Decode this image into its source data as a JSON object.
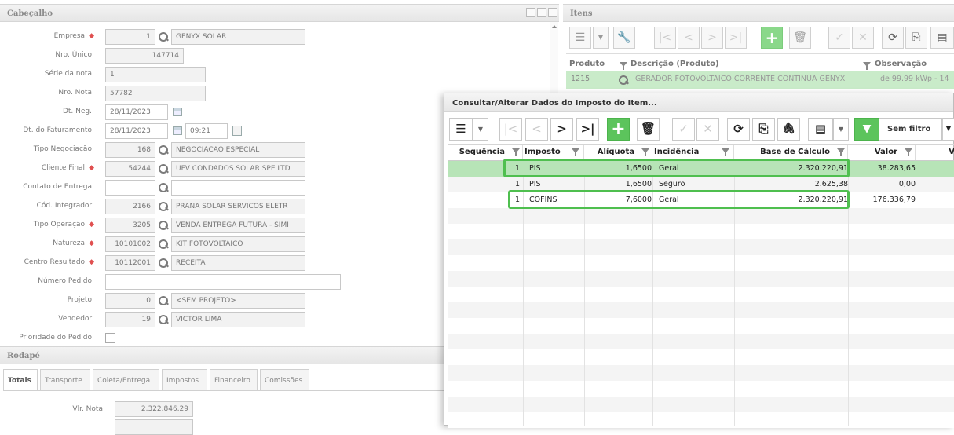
{
  "left": {
    "header_title": "Cabeçalho",
    "fields": [
      {
        "label": "Empresa:",
        "required": true,
        "code": "1",
        "desc": "GENYX SOLAR",
        "search": true
      },
      {
        "label": "Nro. Único:",
        "required": false,
        "value": "147714"
      },
      {
        "label": "Série da nota:",
        "required": false,
        "value": "1"
      },
      {
        "label": "Nro. Nota:",
        "required": false,
        "value": "57782"
      },
      {
        "label": "Dt. Neg.:",
        "required": false,
        "value": "28/11/2023"
      },
      {
        "label": "Dt. do Faturamento:",
        "required": false,
        "value": "28/11/2023",
        "time": "09:21"
      },
      {
        "label": "Tipo Negociação:",
        "required": false,
        "code": "168",
        "desc": "NEGOCIACAO ESPECIAL",
        "search": true
      },
      {
        "label": "Cliente Final:",
        "required": true,
        "code": "54244",
        "desc": "UFV CONDADOS SOLAR SPE LTD",
        "search": true
      },
      {
        "label": "Contato de Entrega:",
        "required": false,
        "code": "",
        "desc": "",
        "search": true
      },
      {
        "label": "Cód. Integrador:",
        "required": false,
        "code": "2166",
        "desc": "PRANA SOLAR SERVICOS ELETR",
        "search": true
      },
      {
        "label": "Tipo Operação:",
        "required": true,
        "code": "3205",
        "desc": "VENDA ENTREGA FUTURA - SIMI",
        "search": true
      },
      {
        "label": "Natureza:",
        "required": true,
        "code": "10101002",
        "desc": "KIT FOTOVOLTAICO",
        "search": true
      },
      {
        "label": "Centro Resultado:",
        "required": true,
        "code": "10112001",
        "desc": "RECEITA",
        "search": true
      },
      {
        "label": "Número Pedido:",
        "required": false,
        "value": ""
      },
      {
        "label": "Projeto:",
        "required": false,
        "code": "0",
        "desc": "<SEM PROJETO>",
        "search": true
      },
      {
        "label": "Vendedor:",
        "required": false,
        "code": "19",
        "desc": "VICTOR LIMA",
        "search": true
      },
      {
        "label": "Prioridade do Pedido:",
        "required": false
      }
    ],
    "footer_title": "Rodapé",
    "tabs": [
      "Totais",
      "Transporte",
      "Coleta/Entrega",
      "Impostos",
      "Financeiro",
      "Comissões"
    ],
    "vlr_nota_label": "Vlr. Nota:",
    "vlr_nota_value": "2.322.846,29"
  },
  "itens": {
    "title": "Itens",
    "columns": [
      "Produto",
      "Descrição (Produto)",
      "Observação"
    ],
    "row": {
      "produto": "1215",
      "descricao": "GERADOR FOTOVOLTAICO CORRENTE CONTINUA GENYX",
      "observacao": "de 99.99 kWp - 14"
    }
  },
  "dialog": {
    "title": "Consultar/Alterar Dados do Imposto do Item...",
    "filter_label": "Sem filtro",
    "columns": [
      "Sequência",
      "Imposto",
      "Alíquota",
      "Incidência",
      "Base de Cálculo",
      "Valor",
      "V"
    ],
    "rows": [
      {
        "seq": "1",
        "imposto": "PIS",
        "aliquota": "1,6500",
        "incidencia": "Geral",
        "base": "2.320.220,91",
        "valor": "38.283,65"
      },
      {
        "seq": "1",
        "imposto": "PIS",
        "aliquota": "1,6500",
        "incidencia": "Seguro",
        "base": "2.625,38",
        "valor": "0,00"
      },
      {
        "seq": "1",
        "imposto": "COFINS",
        "aliquota": "7,6000",
        "incidencia": "Geral",
        "base": "2.320.220,91",
        "valor": "176.336,79"
      }
    ],
    "colors": {
      "selected_row": "#b7e4b7",
      "highlight": "#4fbf4f",
      "accent_green": "#5cc45c"
    }
  }
}
